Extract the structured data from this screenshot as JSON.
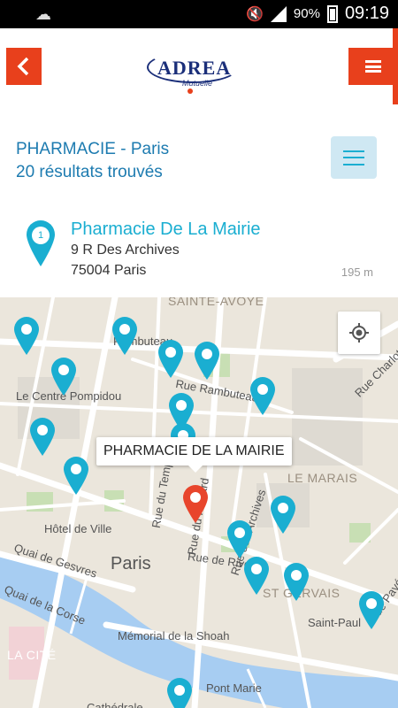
{
  "status_bar": {
    "battery": "90%",
    "time": "09:19",
    "icons": [
      "cloud-icon",
      "mute-icon",
      "signal-icon",
      "battery-icon"
    ]
  },
  "header": {
    "back_icon": "chevron-left-icon",
    "menu_icon": "hamburger-menu-icon",
    "logo": {
      "brand": "ADREA",
      "sub": "Mutuelle"
    },
    "accent_color": "#e8401c",
    "brand_color": "#1b2f7a"
  },
  "results": {
    "title": "PHARMACIE - Paris",
    "count": "20 résultats trouvés",
    "filter_icon": "list-menu-icon",
    "title_color": "#1d7bb0"
  },
  "selected_pharmacy": {
    "index": "1",
    "name": "Pharmacie De La Mairie",
    "address": "9 R Des Archives",
    "city": "75004 Paris",
    "distance": "195 m",
    "pin_color": "#1aaed1"
  },
  "map": {
    "tooltip": "PHARMACIE DE LA MAIRIE",
    "selected_pin_color": "#e8452c",
    "labels": {
      "sainte_avoye": "SAINTE-AVOYE",
      "rambuteau": "Rambuteau",
      "rue_rambuteau": "Rue Rambuteau",
      "rue_charlot": "Rue Charlot",
      "centre_pompidou": "Le Centre Pompidou",
      "le_marais": "LE MARAIS",
      "hotel_de_ville": "Hôtel de Ville",
      "paris": "Paris",
      "quai_gesvres": "Quai de Gesvres",
      "rue_rivoli": "Rue de Rivoli",
      "st_gervais": "ST GERVAIS",
      "rue_payee": "Rue Pavée",
      "quai_corse": "Quai de la Corse",
      "saint_paul": "Saint-Paul",
      "memorial": "Mémorial de la Shoah",
      "la_cite": "LA CITÉ",
      "pont_marie": "Pont Marie",
      "cathedrale": "Cathédrale",
      "rue_du_temple": "Rue du Temple",
      "rue_archives": "Rue des Archives",
      "rue_renard": "Rue du Renard"
    },
    "locate_icon": "my-location-icon"
  }
}
